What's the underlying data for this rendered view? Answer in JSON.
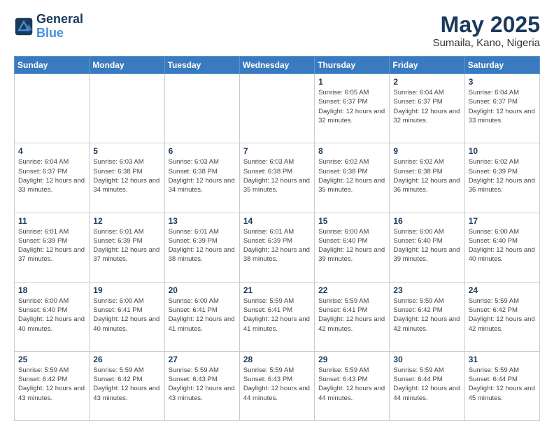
{
  "header": {
    "logo_line1": "General",
    "logo_line2": "Blue",
    "title": "May 2025",
    "subtitle": "Sumaila, Kano, Nigeria"
  },
  "weekdays": [
    "Sunday",
    "Monday",
    "Tuesday",
    "Wednesday",
    "Thursday",
    "Friday",
    "Saturday"
  ],
  "weeks": [
    [
      {
        "day": "",
        "info": ""
      },
      {
        "day": "",
        "info": ""
      },
      {
        "day": "",
        "info": ""
      },
      {
        "day": "",
        "info": ""
      },
      {
        "day": "1",
        "info": "Sunrise: 6:05 AM\nSunset: 6:37 PM\nDaylight: 12 hours\nand 32 minutes."
      },
      {
        "day": "2",
        "info": "Sunrise: 6:04 AM\nSunset: 6:37 PM\nDaylight: 12 hours\nand 32 minutes."
      },
      {
        "day": "3",
        "info": "Sunrise: 6:04 AM\nSunset: 6:37 PM\nDaylight: 12 hours\nand 33 minutes."
      }
    ],
    [
      {
        "day": "4",
        "info": "Sunrise: 6:04 AM\nSunset: 6:37 PM\nDaylight: 12 hours\nand 33 minutes."
      },
      {
        "day": "5",
        "info": "Sunrise: 6:03 AM\nSunset: 6:38 PM\nDaylight: 12 hours\nand 34 minutes."
      },
      {
        "day": "6",
        "info": "Sunrise: 6:03 AM\nSunset: 6:38 PM\nDaylight: 12 hours\nand 34 minutes."
      },
      {
        "day": "7",
        "info": "Sunrise: 6:03 AM\nSunset: 6:38 PM\nDaylight: 12 hours\nand 35 minutes."
      },
      {
        "day": "8",
        "info": "Sunrise: 6:02 AM\nSunset: 6:38 PM\nDaylight: 12 hours\nand 35 minutes."
      },
      {
        "day": "9",
        "info": "Sunrise: 6:02 AM\nSunset: 6:38 PM\nDaylight: 12 hours\nand 36 minutes."
      },
      {
        "day": "10",
        "info": "Sunrise: 6:02 AM\nSunset: 6:39 PM\nDaylight: 12 hours\nand 36 minutes."
      }
    ],
    [
      {
        "day": "11",
        "info": "Sunrise: 6:01 AM\nSunset: 6:39 PM\nDaylight: 12 hours\nand 37 minutes."
      },
      {
        "day": "12",
        "info": "Sunrise: 6:01 AM\nSunset: 6:39 PM\nDaylight: 12 hours\nand 37 minutes."
      },
      {
        "day": "13",
        "info": "Sunrise: 6:01 AM\nSunset: 6:39 PM\nDaylight: 12 hours\nand 38 minutes."
      },
      {
        "day": "14",
        "info": "Sunrise: 6:01 AM\nSunset: 6:39 PM\nDaylight: 12 hours\nand 38 minutes."
      },
      {
        "day": "15",
        "info": "Sunrise: 6:00 AM\nSunset: 6:40 PM\nDaylight: 12 hours\nand 39 minutes."
      },
      {
        "day": "16",
        "info": "Sunrise: 6:00 AM\nSunset: 6:40 PM\nDaylight: 12 hours\nand 39 minutes."
      },
      {
        "day": "17",
        "info": "Sunrise: 6:00 AM\nSunset: 6:40 PM\nDaylight: 12 hours\nand 40 minutes."
      }
    ],
    [
      {
        "day": "18",
        "info": "Sunrise: 6:00 AM\nSunset: 6:40 PM\nDaylight: 12 hours\nand 40 minutes."
      },
      {
        "day": "19",
        "info": "Sunrise: 6:00 AM\nSunset: 6:41 PM\nDaylight: 12 hours\nand 40 minutes."
      },
      {
        "day": "20",
        "info": "Sunrise: 6:00 AM\nSunset: 6:41 PM\nDaylight: 12 hours\nand 41 minutes."
      },
      {
        "day": "21",
        "info": "Sunrise: 5:59 AM\nSunset: 6:41 PM\nDaylight: 12 hours\nand 41 minutes."
      },
      {
        "day": "22",
        "info": "Sunrise: 5:59 AM\nSunset: 6:41 PM\nDaylight: 12 hours\nand 42 minutes."
      },
      {
        "day": "23",
        "info": "Sunrise: 5:59 AM\nSunset: 6:42 PM\nDaylight: 12 hours\nand 42 minutes."
      },
      {
        "day": "24",
        "info": "Sunrise: 5:59 AM\nSunset: 6:42 PM\nDaylight: 12 hours\nand 42 minutes."
      }
    ],
    [
      {
        "day": "25",
        "info": "Sunrise: 5:59 AM\nSunset: 6:42 PM\nDaylight: 12 hours\nand 43 minutes."
      },
      {
        "day": "26",
        "info": "Sunrise: 5:59 AM\nSunset: 6:42 PM\nDaylight: 12 hours\nand 43 minutes."
      },
      {
        "day": "27",
        "info": "Sunrise: 5:59 AM\nSunset: 6:43 PM\nDaylight: 12 hours\nand 43 minutes."
      },
      {
        "day": "28",
        "info": "Sunrise: 5:59 AM\nSunset: 6:43 PM\nDaylight: 12 hours\nand 44 minutes."
      },
      {
        "day": "29",
        "info": "Sunrise: 5:59 AM\nSunset: 6:43 PM\nDaylight: 12 hours\nand 44 minutes."
      },
      {
        "day": "30",
        "info": "Sunrise: 5:59 AM\nSunset: 6:44 PM\nDaylight: 12 hours\nand 44 minutes."
      },
      {
        "day": "31",
        "info": "Sunrise: 5:59 AM\nSunset: 6:44 PM\nDaylight: 12 hours\nand 45 minutes."
      }
    ]
  ]
}
